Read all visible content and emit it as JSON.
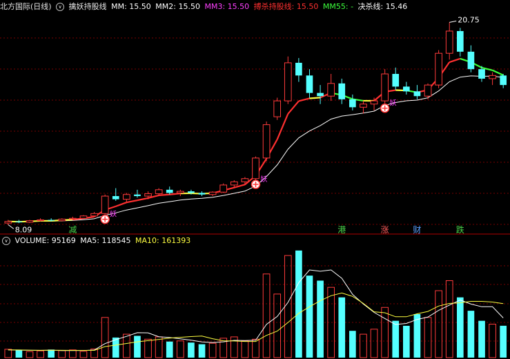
{
  "header": {
    "symbol": "北方国际",
    "period": "(日线)",
    "indicator": "擒妖持股线",
    "mm": {
      "label": "MM:",
      "value": "15.50"
    },
    "mm2": {
      "label": "MM2:",
      "value": "15.50"
    },
    "mm3": {
      "label": "MM3:",
      "value": "15.50"
    },
    "bosha": {
      "label": "搏杀持股线:",
      "value": "15.50"
    },
    "mm55": {
      "label": "MM55:",
      "value": "-"
    },
    "juesha": {
      "label": "决杀线:",
      "value": "15.46"
    }
  },
  "volume_header": {
    "label": "VOLUME:",
    "value": "95169",
    "ma5_label": "MA5:",
    "ma5": "118545",
    "ma10_label": "MA10:",
    "ma10": "161393"
  },
  "annotations": {
    "high": "20.75",
    "low": "8.09",
    "marks": [
      {
        "text": "减",
        "color": "#4ad44a",
        "index": 6
      },
      {
        "text": "港",
        "color": "#4ad44a",
        "index": 31
      },
      {
        "text": "涨",
        "color": "#ff5a5a",
        "index": 35
      },
      {
        "text": "财",
        "color": "#5aa0ff",
        "index": 38
      },
      {
        "text": "跌",
        "color": "#4ad44a",
        "index": 42
      }
    ],
    "yao_label": "妖",
    "buy_signal_indices": [
      9,
      23,
      35
    ]
  },
  "colors": {
    "up": "#ff3b3b",
    "down": "#54ffff",
    "mm3": "#ff40ff",
    "bosha": "#ff3030",
    "mm55": "#3cff3c",
    "grid": "#7a0000",
    "white_line": "#ffffff",
    "yellow_line": "#ffff40"
  },
  "chart_data": [
    {
      "type": "candlestick",
      "title": "北方国际 (日线) 擒妖持股线",
      "ylim": [
        7.8,
        21.2
      ],
      "ohlc": [
        [
          8.1,
          8.3,
          8.0,
          8.2
        ],
        [
          8.2,
          8.3,
          8.1,
          8.15
        ],
        [
          8.15,
          8.3,
          8.1,
          8.25
        ],
        [
          8.25,
          8.4,
          8.2,
          8.3
        ],
        [
          8.3,
          8.4,
          8.2,
          8.25
        ],
        [
          8.25,
          8.4,
          8.2,
          8.35
        ],
        [
          8.35,
          8.5,
          8.3,
          8.4
        ],
        [
          8.4,
          8.6,
          8.35,
          8.55
        ],
        [
          8.55,
          8.8,
          8.5,
          8.7
        ],
        [
          8.7,
          9.9,
          8.6,
          9.8
        ],
        [
          9.8,
          10.3,
          9.5,
          9.6
        ],
        [
          9.6,
          10.0,
          9.4,
          9.9
        ],
        [
          9.9,
          10.2,
          9.7,
          9.8
        ],
        [
          9.8,
          10.1,
          9.6,
          9.95
        ],
        [
          9.95,
          10.3,
          9.8,
          10.2
        ],
        [
          10.2,
          10.4,
          9.9,
          10.0
        ],
        [
          10.0,
          10.2,
          9.8,
          10.1
        ],
        [
          10.1,
          10.2,
          9.9,
          10.0
        ],
        [
          10.0,
          10.1,
          9.8,
          9.9
        ],
        [
          9.9,
          10.1,
          9.8,
          10.05
        ],
        [
          10.05,
          10.6,
          10.0,
          10.5
        ],
        [
          10.5,
          10.8,
          10.3,
          10.7
        ],
        [
          10.7,
          11.0,
          10.5,
          10.9
        ],
        [
          10.9,
          12.3,
          10.8,
          12.2
        ],
        [
          12.2,
          14.5,
          12.0,
          14.3
        ],
        [
          14.8,
          16.0,
          14.6,
          15.8
        ],
        [
          15.8,
          18.6,
          15.6,
          18.2
        ],
        [
          18.2,
          18.5,
          17.0,
          17.4
        ],
        [
          17.4,
          17.8,
          16.0,
          16.3
        ],
        [
          16.3,
          16.8,
          15.6,
          16.1
        ],
        [
          16.1,
          17.5,
          15.8,
          16.9
        ],
        [
          16.9,
          17.2,
          15.6,
          15.9
        ],
        [
          15.9,
          16.2,
          15.2,
          15.4
        ],
        [
          15.4,
          15.8,
          15.0,
          15.6
        ],
        [
          15.6,
          16.0,
          15.2,
          15.8
        ],
        [
          15.8,
          17.8,
          15.6,
          17.5
        ],
        [
          17.5,
          17.9,
          16.5,
          16.7
        ],
        [
          16.7,
          17.0,
          16.2,
          16.4
        ],
        [
          16.4,
          16.8,
          15.9,
          16.1
        ],
        [
          16.1,
          16.9,
          15.9,
          16.8
        ],
        [
          16.8,
          19.0,
          16.6,
          18.8
        ],
        [
          18.8,
          20.75,
          18.4,
          20.2
        ],
        [
          20.2,
          20.4,
          18.6,
          18.9
        ],
        [
          18.9,
          19.3,
          17.6,
          17.8
        ],
        [
          17.8,
          18.0,
          17.0,
          17.2
        ],
        [
          17.2,
          17.6,
          16.8,
          17.4
        ],
        [
          17.4,
          17.5,
          16.6,
          16.8
        ]
      ]
    },
    {
      "type": "bar",
      "title": "VOLUME",
      "ylim": [
        0,
        330000
      ],
      "values": [
        25000,
        22000,
        18000,
        20000,
        24000,
        21000,
        23000,
        19000,
        26000,
        120000,
        60000,
        70000,
        65000,
        55000,
        62000,
        48000,
        50000,
        45000,
        40000,
        43000,
        58000,
        62000,
        50000,
        55000,
        250000,
        190000,
        305000,
        320000,
        245000,
        230000,
        210000,
        180000,
        80000,
        70000,
        85000,
        150000,
        110000,
        95000,
        130000,
        120000,
        200000,
        230000,
        180000,
        140000,
        110000,
        100000,
        95169
      ],
      "ma5": [
        23000,
        22500,
        21800,
        21600,
        22000,
        21200,
        21000,
        21400,
        22600,
        41800,
        53600,
        63600,
        74400,
        74000,
        62400,
        60000,
        56000,
        52000,
        47000,
        45200,
        47200,
        51600,
        51000,
        52000,
        99200,
        123000,
        165000,
        224000,
        262000,
        258000,
        262000,
        237000,
        189000,
        160000,
        135000,
        117000,
        99000,
        102000,
        114000,
        121000,
        141000,
        157000,
        172000,
        160000,
        152000,
        152000,
        118545
      ],
      "ma10": [
        23000,
        22800,
        22200,
        21800,
        22000,
        21800,
        21600,
        21500,
        21600,
        33000,
        37400,
        42200,
        47300,
        50800,
        54400,
        58300,
        60700,
        62900,
        64300,
        56500,
        50400,
        49700,
        48200,
        48200,
        66500,
        79300,
        105000,
        132500,
        152000,
        170000,
        185000,
        193000,
        183000,
        162000,
        137000,
        134000,
        122000,
        122000,
        131000,
        138000,
        154000,
        162000,
        164000,
        168000,
        168000,
        166000,
        161393
      ]
    }
  ]
}
